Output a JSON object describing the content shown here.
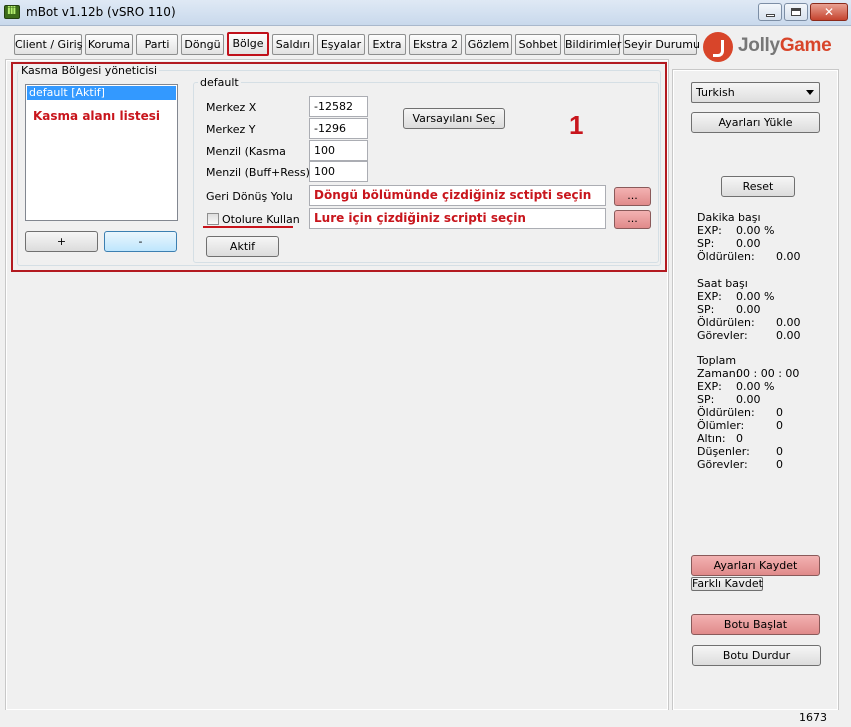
{
  "window": {
    "title": "mBot v1.12b (vSRO 110)"
  },
  "tabs": [
    "Client / Giriş",
    "Koruma",
    "Parti",
    "Döngü",
    "Bölge",
    "Saldırı",
    "Eşyalar",
    "Extra",
    "Ekstra 2",
    "Gözlem",
    "Sohbet",
    "Bildirimler",
    "Seyir Durumu"
  ],
  "active_tab": "Bölge",
  "logo": {
    "part1": "Jolly",
    "part2": "Game"
  },
  "area_manager": {
    "group_title": "Kasma Bölgesi yöneticisi",
    "list_items": [
      "default [Aktif]"
    ],
    "annotation": "Kasma alanı listesi",
    "add_label": "+",
    "remove_label": "-"
  },
  "area_settings": {
    "group_title": "default",
    "center_x_label": "Merkez X",
    "center_x_value": "-12582",
    "center_y_label": "Merkez Y",
    "center_y_value": "-1296",
    "range_label": "Menzil (Kasma",
    "range_value": "100",
    "range_buff_label": "Menzil (Buff+Ress)",
    "range_buff_value": "100",
    "default_button": "Varsayılanı Seç",
    "return_path_label": "Geri Dönüş Yolu",
    "return_path_value": "Döngü bölümünde çizdiğiniz sctipti seçin",
    "browse_label": "...",
    "auto_lure_label": "Otolure Kullan",
    "lure_script_value": "Lure için çizdiğiniz scripti seçin",
    "activate_button": "Aktif",
    "marker_number": "1"
  },
  "sidebar": {
    "language": "Turkish",
    "load_settings": "Ayarları Yükle",
    "reset": "Reset",
    "per_minute": {
      "title": "Dakika başı",
      "exp_label": "EXP:",
      "exp_value": "0.00 %",
      "sp_label": "SP:",
      "sp_value": "0.00",
      "kills_label": "Öldürülen:",
      "kills_value": "0.00"
    },
    "per_hour": {
      "title": "Saat başı",
      "exp_label": "EXP:",
      "exp_value": "0.00 %",
      "sp_label": "SP:",
      "sp_value": "0.00",
      "kills_label": "Öldürülen:",
      "kills_value": "0.00",
      "quests_label": "Görevler:",
      "quests_value": "0.00"
    },
    "total": {
      "title": "Toplam",
      "time_label": "Zaman:",
      "time_value": "00 : 00 : 00",
      "exp_label": "EXP:",
      "exp_value": "0.00 %",
      "sp_label": "SP:",
      "sp_value": "0.00",
      "kills_label": "Öldürülen:",
      "kills_value": "0",
      "deaths_label": "Ölümler:",
      "deaths_value": "0",
      "gold_label": "Altın:",
      "gold_value": "0",
      "drops_label": "Düşenler:",
      "drops_value": "0",
      "quests_label": "Görevler:",
      "quests_value": "0"
    },
    "save_settings": "Ayarları Kaydet",
    "save_as": "Farklı Kavdet",
    "start_bot": "Botu Başlat",
    "stop_bot": "Botu Durdur"
  },
  "status": {
    "value": "1673"
  },
  "colors": {
    "annotation_red": "#c8151c",
    "selection_blue": "#3399ff",
    "pink_button": "#e08a8a"
  }
}
